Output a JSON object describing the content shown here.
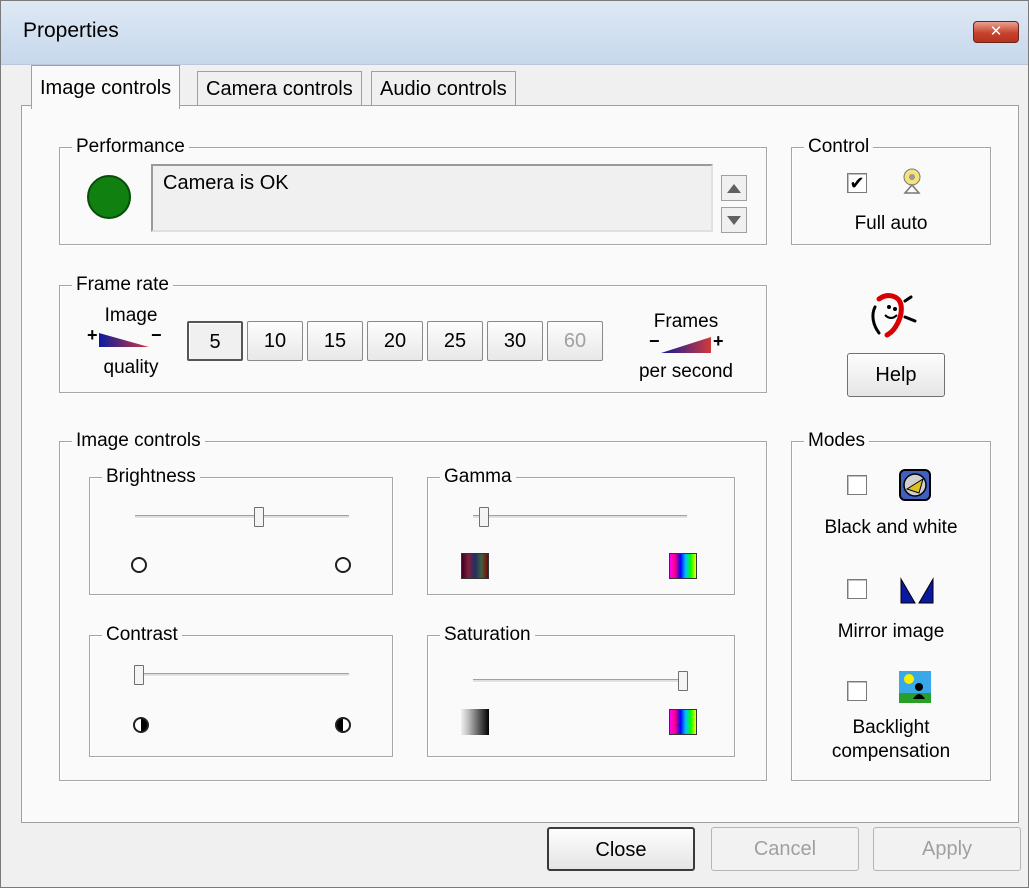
{
  "window": {
    "title": "Properties",
    "close_icon": "close-icon"
  },
  "tabs": [
    {
      "label": "Image controls"
    },
    {
      "label": "Camera controls"
    },
    {
      "label": "Audio controls"
    }
  ],
  "performance": {
    "label": "Performance",
    "status_color": "#108010",
    "status_text": "Camera is OK"
  },
  "control": {
    "label": "Control",
    "checked": true,
    "option_label": "Full auto",
    "checkmark": "✔"
  },
  "frame_rate": {
    "label": "Frame rate",
    "left_label_top": "Image",
    "left_label_bottom": "quality",
    "right_label_top": "Frames",
    "right_label_bottom": "per second",
    "plus": "+",
    "minus": "−",
    "options": [
      "5",
      "10",
      "15",
      "20",
      "25",
      "30",
      "60"
    ],
    "selected": "5",
    "disabled": [
      "60"
    ]
  },
  "help": {
    "button_label": "Help",
    "mascot_icon": "mascot-icon"
  },
  "image_controls": {
    "label": "Image controls",
    "brightness": {
      "label": "Brightness",
      "value": 0.58
    },
    "gamma": {
      "label": "Gamma",
      "value": 0.05
    },
    "contrast": {
      "label": "Contrast",
      "value": 0.0
    },
    "saturation": {
      "label": "Saturation",
      "value": 1.0
    }
  },
  "modes": {
    "label": "Modes",
    "items": [
      {
        "label": "Black and white",
        "checked": false,
        "icon": "black-and-white-icon"
      },
      {
        "label": "Mirror image",
        "checked": false,
        "icon": "mirror-icon"
      },
      {
        "label_line1": "Backlight",
        "label_line2": "compensation",
        "checked": false,
        "icon": "backlight-icon"
      }
    ]
  },
  "footer": {
    "close": "Close",
    "cancel": "Cancel",
    "apply": "Apply"
  }
}
